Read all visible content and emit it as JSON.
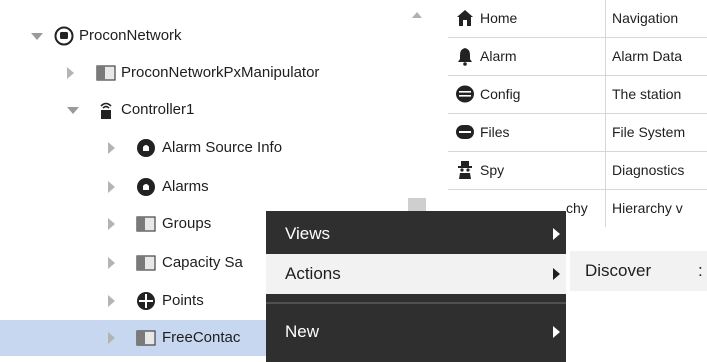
{
  "tree": {
    "items": [
      {
        "label": "ProconNetwork",
        "icon": "network-icon",
        "expanded": true
      },
      {
        "label": "ProconNetworkPxManipulator",
        "icon": "folder-icon",
        "expanded": false
      },
      {
        "label": "Controller1",
        "icon": "controller-icon",
        "expanded": true
      },
      {
        "label": "Alarm Source Info",
        "icon": "alarm-source-icon",
        "expanded": false
      },
      {
        "label": "Alarms",
        "icon": "alarms-icon",
        "expanded": false
      },
      {
        "label": "Groups",
        "icon": "folder-icon",
        "expanded": false
      },
      {
        "label": "Capacity Sa",
        "icon": "folder-icon",
        "expanded": false
      },
      {
        "label": "Points",
        "icon": "points-icon",
        "expanded": false
      },
      {
        "label": "FreeContac",
        "icon": "folder-icon",
        "expanded": false,
        "selected": true
      }
    ]
  },
  "table": {
    "rows": [
      {
        "name": "Home",
        "description": "Navigation",
        "icon": "home-icon"
      },
      {
        "name": "Alarm",
        "description": "Alarm Data",
        "icon": "bell-icon"
      },
      {
        "name": "Config",
        "description": "The station",
        "icon": "database-icon"
      },
      {
        "name": "Files",
        "description": "File System",
        "icon": "drive-icon"
      },
      {
        "name": "Spy",
        "description": "Diagnostics",
        "icon": "spy-icon"
      },
      {
        "name": "chy",
        "description": "Hierarchy v",
        "icon": ""
      }
    ]
  },
  "context_menu": {
    "items": [
      {
        "label": "Views",
        "has_submenu": true
      },
      {
        "label": "Actions",
        "has_submenu": true,
        "highlighted": true
      },
      {
        "label": "New",
        "has_submenu": true
      }
    ],
    "submenu": {
      "label": "Discover",
      "trailing": ":"
    }
  },
  "colors": {
    "selection": "#c7d7f0",
    "menu_bg": "#2f2f2f",
    "menu_highlight": "#f2f2f2"
  }
}
